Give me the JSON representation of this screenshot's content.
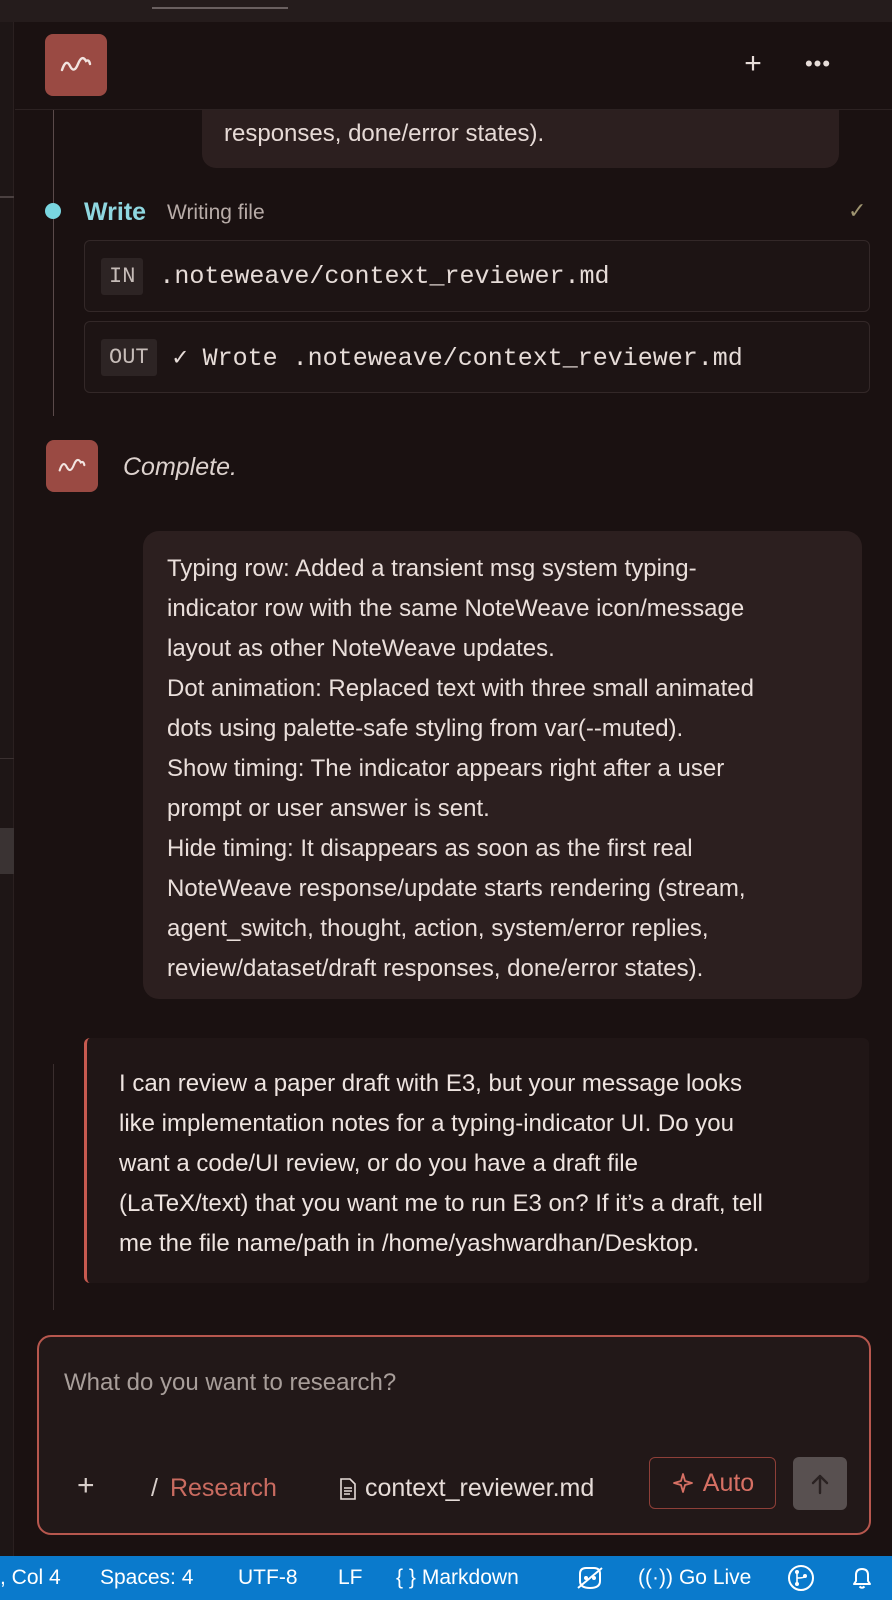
{
  "header": {
    "new_chat_label": "+",
    "more_label": "•••"
  },
  "previous_message": {
    "tail_text": "responses, done/error states)."
  },
  "write_step": {
    "title": "Write",
    "subtitle": "Writing file",
    "status_icon": "check-icon",
    "input_tag": "IN",
    "input_text": ".noteweave/context_reviewer.md",
    "output_tag": "OUT",
    "output_text": "✓ Wrote .noteweave/context_reviewer.md"
  },
  "complete": {
    "text": "Complete."
  },
  "summary_message": {
    "lines": [
      "Typing row: Added a transient msg system typing-",
      "indicator row with the same NoteWeave icon/message",
      "layout as other NoteWeave updates.",
      "Dot animation: Replaced text with three small animated",
      "dots using palette-safe styling from var(--muted).",
      "Show timing: The indicator appears right after a user",
      "prompt or user answer is sent.",
      "Hide timing: It disappears as soon as the first real",
      "NoteWeave response/update starts rendering (stream,",
      "agent_switch, thought, action, system/error replies,",
      "review/dataset/draft responses, done/error states)."
    ]
  },
  "reply_message": {
    "lines": [
      "I can review a paper draft with E3, but your message looks",
      "like implementation notes for a typing-indicator UI. Do you",
      "want a code/UI review, or do you have a draft file",
      "(LaTeX/text) that you want me to run E3 on? If it’s a draft, tell",
      "me the file name/path in /home/yashwardhan/Desktop."
    ]
  },
  "composer": {
    "placeholder": "What do you want to research?",
    "plus_label": "+",
    "mode_slash": "/",
    "mode_label": "Research",
    "file_label": "context_reviewer.md",
    "auto_label": "Auto"
  },
  "statusbar": {
    "position": ", Col 4",
    "spaces": "Spaces: 4",
    "encoding": "UTF-8",
    "eol": "LF",
    "language_braces": "{ }",
    "language": "Markdown",
    "go_live": "Go Live",
    "go_live_icon": "((·))"
  },
  "colors": {
    "accent": "#c75a50",
    "logo_bg": "#9a4a43",
    "write_step": "#8fd7e0",
    "statusbar": "#0a7acc"
  }
}
